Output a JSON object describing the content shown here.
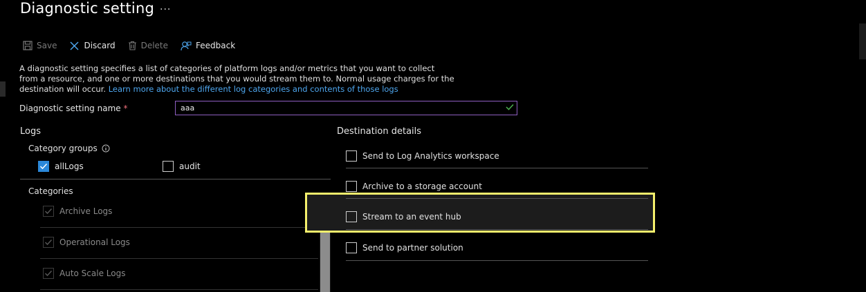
{
  "header": {
    "title": "Diagnostic setting",
    "more": "···"
  },
  "toolbar": {
    "save_label": "Save",
    "discard_label": "Discard",
    "delete_label": "Delete",
    "feedback_label": "Feedback"
  },
  "description": {
    "text": "A diagnostic setting specifies a list of categories of platform logs and/or metrics that you want to collect from a resource, and one or more destinations that you would stream them to. Normal usage charges for the destination will occur. ",
    "link": "Learn more about the different log categories and contents of those logs"
  },
  "name_field": {
    "label": "Diagnostic setting name",
    "required_mark": "*",
    "value": "aaa"
  },
  "logs": {
    "heading": "Logs",
    "category_groups_label": "Category groups",
    "groups": [
      {
        "label": "allLogs",
        "checked": true
      },
      {
        "label": "audit",
        "checked": false
      }
    ],
    "categories_label": "Categories",
    "categories": [
      {
        "label": "Archive Logs",
        "checked": true
      },
      {
        "label": "Operational Logs",
        "checked": true
      },
      {
        "label": "Auto Scale Logs",
        "checked": true
      }
    ]
  },
  "destinations": {
    "heading": "Destination details",
    "items": [
      {
        "label": "Send to Log Analytics workspace",
        "checked": false
      },
      {
        "label": "Archive to a storage account",
        "checked": false
      },
      {
        "label": "Stream to an event hub",
        "checked": false
      },
      {
        "label": "Send to partner solution",
        "checked": false
      }
    ]
  },
  "colors": {
    "accent": "#2b88d8",
    "link": "#4ea6ee",
    "highlight": "#f5f06c",
    "input_border": "#8f5fc2",
    "valid": "#4caf50"
  }
}
